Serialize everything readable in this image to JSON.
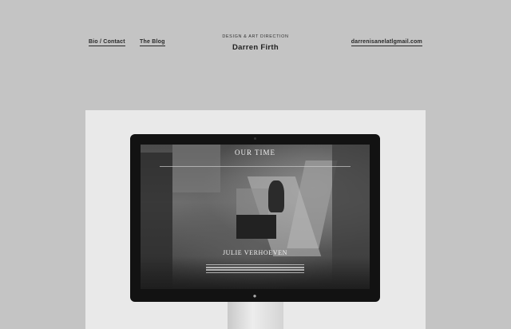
{
  "header": {
    "nav_left": [
      {
        "label": "Bio / Contact"
      },
      {
        "label": "The Blog"
      }
    ],
    "brand_subtitle": "DESIGN & ART DIRECTION",
    "brand_title": "Darren Firth",
    "email": "darrenisanelatlgmail.com"
  },
  "showcase": {
    "site_title": "OUR TIME",
    "site_subtitle": "",
    "site_nav": [
      "",
      "",
      "",
      "",
      ""
    ],
    "hero_name": "JULIE VERHOEVEN",
    "hero_tag": ""
  },
  "colors": {
    "page_background": "#c4c4c4",
    "panel_background": "#e9e9e9",
    "monitor_bezel": "#121212",
    "text": "#222222"
  },
  "icons": {
    "monitor_logo": "apple-logo-icon"
  }
}
